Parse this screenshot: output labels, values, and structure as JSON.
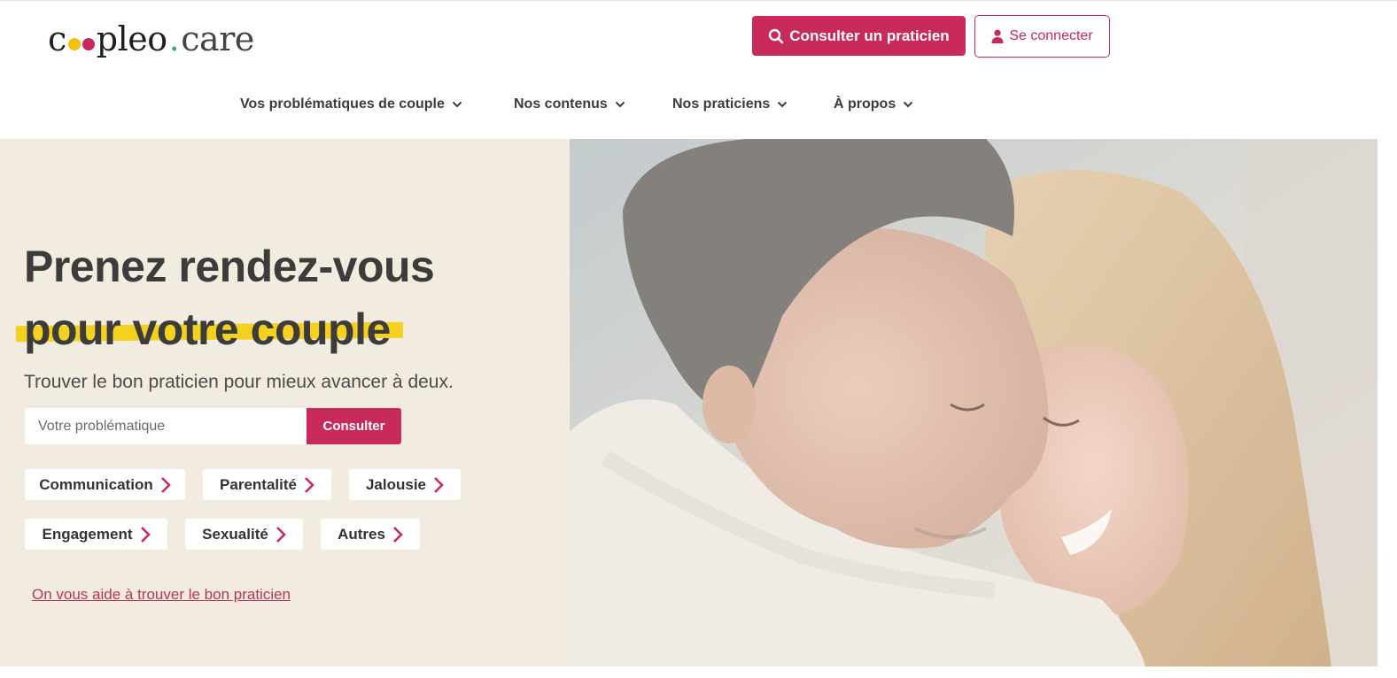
{
  "header": {
    "logo": {
      "left": "c",
      "right": "pleo",
      "separator": ".",
      "suffix": "care"
    },
    "consult_button": "Consulter un praticien",
    "login_button": "Se connecter"
  },
  "nav": {
    "items": [
      {
        "label": "Vos problématiques de couple"
      },
      {
        "label": "Nos contenus"
      },
      {
        "label": "Nos praticiens"
      },
      {
        "label": "À propos"
      }
    ]
  },
  "hero": {
    "title_line1": "Prenez rendez-vous",
    "title_line2": "pour votre couple",
    "subtitle": "Trouver le bon praticien pour mieux avancer à deux.",
    "search": {
      "placeholder": "Votre problématique",
      "value": "",
      "button": "Consulter"
    },
    "chips": [
      {
        "label": "Communication"
      },
      {
        "label": "Parentalité"
      },
      {
        "label": "Jalousie"
      },
      {
        "label": "Engagement"
      },
      {
        "label": "Sexualité"
      },
      {
        "label": "Autres"
      }
    ],
    "help_link": "On vous aide à trouver le bon praticien",
    "image_description": "couple-photo"
  },
  "colors": {
    "brand": "#c92a5c",
    "highlight": "#f4d11f",
    "hero_bg": "#f2ebdf",
    "logo_dot_yellow": "#f4c20d",
    "logo_dot_pink": "#c92a5c"
  }
}
